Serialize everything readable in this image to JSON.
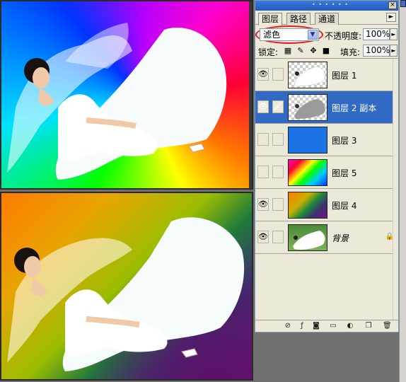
{
  "panel": {
    "tabs": [
      {
        "label": "图层",
        "active": true
      },
      {
        "label": "路径",
        "active": false
      },
      {
        "label": "通道",
        "active": false
      }
    ],
    "blend_mode": "滤色",
    "opacity_label": "不透明度:",
    "opacity_value": "100%",
    "lock_label": "锁定:",
    "fill_label": "填充:",
    "fill_value": "100%",
    "close_icon": "×",
    "menu_icon": "►",
    "highlight_color": "#e11c1c",
    "selection_color": "#316ac5"
  },
  "layers": [
    {
      "name": "图层 1",
      "visible": true,
      "linked_icon": "",
      "thumb": "white-dress"
    },
    {
      "name": "图层 2 副本",
      "visible": true,
      "linked_icon": "brush",
      "thumb": "grey-dress",
      "selected": true
    },
    {
      "name": "图层 3",
      "visible": false,
      "linked_icon": "",
      "thumb": "solid-blue"
    },
    {
      "name": "图层 5",
      "visible": false,
      "linked_icon": "",
      "thumb": "rainbow"
    },
    {
      "name": "图层 4",
      "visible": true,
      "linked_icon": "",
      "thumb": "orange-purple-gradient"
    },
    {
      "name": "背景",
      "visible": true,
      "linked_icon": "",
      "thumb": "photo",
      "locked": true
    }
  ],
  "bottom_icons": [
    "link-icon",
    "fx-icon",
    "mask-icon",
    "folder-icon",
    "adjustment-icon",
    "new-layer-icon",
    "trash-icon"
  ]
}
